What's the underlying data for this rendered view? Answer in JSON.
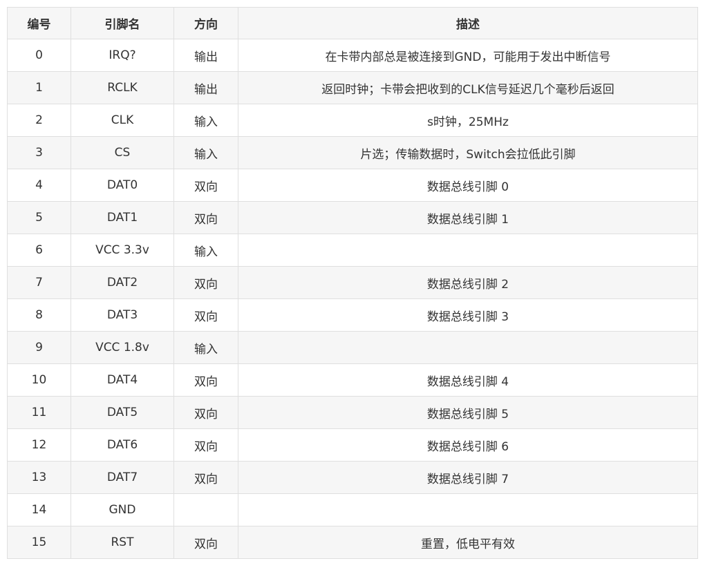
{
  "table": {
    "headers": [
      "编号",
      "引脚名",
      "方向",
      "描述"
    ],
    "rows": [
      [
        "0",
        "IRQ?",
        "输出",
        "在卡带内部总是被连接到GND，可能用于发出中断信号"
      ],
      [
        "1",
        "RCLK",
        "输出",
        "返回时钟；卡带会把收到的CLK信号延迟几个毫秒后返回"
      ],
      [
        "2",
        "CLK",
        "输入",
        "s时钟，25MHz"
      ],
      [
        "3",
        "CS",
        "输入",
        "片选；传输数据时，Switch会拉低此引脚"
      ],
      [
        "4",
        "DAT0",
        "双向",
        "数据总线引脚 0"
      ],
      [
        "5",
        "DAT1",
        "双向",
        "数据总线引脚 1"
      ],
      [
        "6",
        "VCC 3.3v",
        "输入",
        ""
      ],
      [
        "7",
        "DAT2",
        "双向",
        "数据总线引脚 2"
      ],
      [
        "8",
        "DAT3",
        "双向",
        "数据总线引脚 3"
      ],
      [
        "9",
        "VCC 1.8v",
        "输入",
        ""
      ],
      [
        "10",
        "DAT4",
        "双向",
        "数据总线引脚 4"
      ],
      [
        "11",
        "DAT5",
        "双向",
        "数据总线引脚 5"
      ],
      [
        "12",
        "DAT6",
        "双向",
        "数据总线引脚 6"
      ],
      [
        "13",
        "DAT7",
        "双向",
        "数据总线引脚 7"
      ],
      [
        "14",
        "GND",
        "",
        ""
      ],
      [
        "15",
        "RST",
        "双向",
        "重置，低电平有效"
      ]
    ]
  }
}
